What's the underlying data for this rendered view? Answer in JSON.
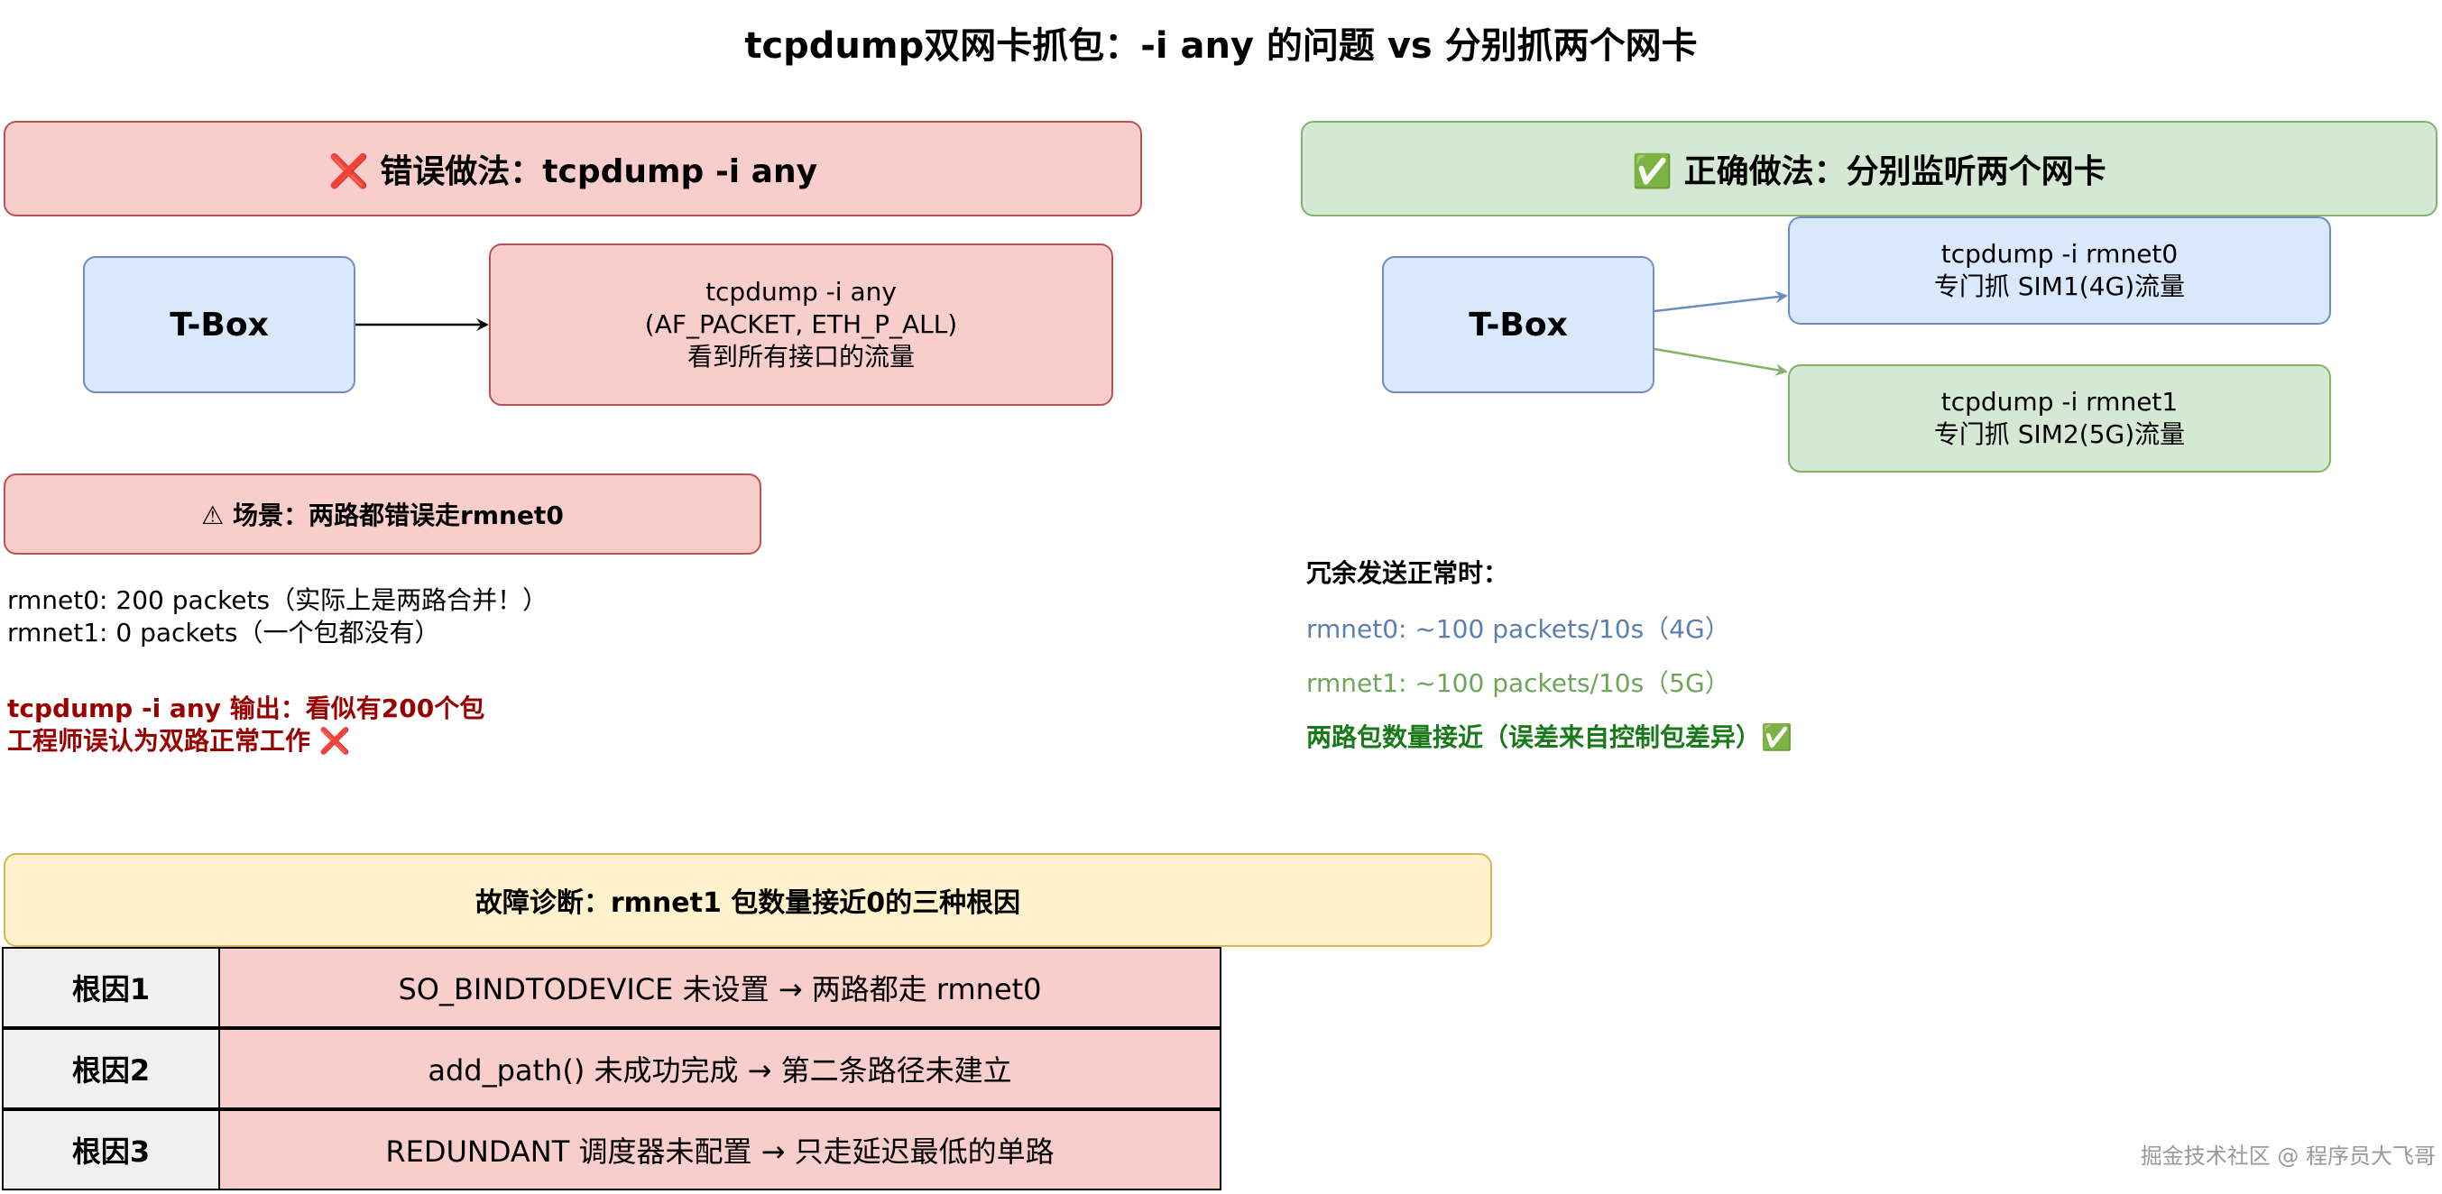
{
  "title": "tcpdump双网卡抓包：-i any 的问题 vs 分别抓两个网卡",
  "wrong": {
    "header": "❌ 错误做法：tcpdump -i any",
    "tbox": "T-Box",
    "capture": "tcpdump -i any\n(AF_PACKET, ETH_P_ALL)\n看到所有接口的流量",
    "scenario": "⚠ 场景：两路都错误走rmnet0",
    "stats": "rmnet0: 200 packets（实际上是两路合并！）\nrmnet1: 0 packets（一个包都没有）",
    "conclusion": "tcpdump -i any 输出：看似有200个包\n工程师误认为双路正常工作 ❌"
  },
  "right": {
    "header": "✅ 正确做法：分别监听两个网卡",
    "tbox": "T-Box",
    "cap0": "tcpdump -i rmnet0\n专门抓 SIM1(4G)流量",
    "cap1": "tcpdump -i rmnet1\n专门抓 SIM2(5G)流量",
    "normal_label": "冗余发送正常时：",
    "rmnet0_rate": "rmnet0: ~100 packets/10s（4G）",
    "rmnet1_rate": "rmnet1: ~100 packets/10s（5G）",
    "summary": "两路包数量接近（误差来自控制包差异）✅"
  },
  "diagnosis": {
    "header": "故障诊断：rmnet1 包数量接近0的三种根因",
    "rows": [
      {
        "label": "根因1",
        "text": "SO_BINDTODEVICE 未设置 → 两路都走 rmnet0"
      },
      {
        "label": "根因2",
        "text": "add_path() 未成功完成 → 第二条路径未建立"
      },
      {
        "label": "根因3",
        "text": "REDUNDANT 调度器未配置 → 只走延迟最低的单路"
      }
    ]
  },
  "watermark": "掘金技术社区 @ 程序员大飞哥",
  "colors": {
    "red_fill": "#f8cecc",
    "red_stroke": "#b85450",
    "green_fill": "#d5e8d4",
    "green_stroke": "#82b366",
    "blue_fill": "#dae8fc",
    "blue_stroke": "#6c8ebf",
    "yellow_fill": "#fff2cc",
    "yellow_stroke": "#d6b656",
    "dark_red_text": "#990000",
    "dark_green_text": "#1a7a1a",
    "muted_blue_text": "#5a7fb0",
    "muted_green_text": "#6fa55a"
  }
}
